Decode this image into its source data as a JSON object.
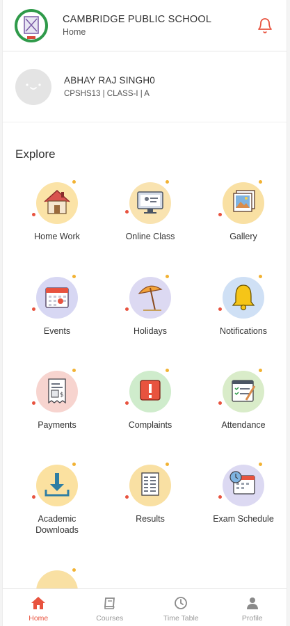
{
  "header": {
    "school_name": "CAMBRIDGE PUBLIC SCHOOL",
    "breadcrumb": "Home"
  },
  "profile": {
    "name": "ABHAY RAJ SINGH0",
    "meta": "CPSHS13 | CLASS-I | A"
  },
  "explore_title": "Explore",
  "explore_items": [
    {
      "label": "Home Work",
      "icon": "home-icon"
    },
    {
      "label": "Online Class",
      "icon": "online-class-icon"
    },
    {
      "label": "Gallery",
      "icon": "gallery-icon"
    },
    {
      "label": "Events",
      "icon": "calendar-icon"
    },
    {
      "label": "Holidays",
      "icon": "beach-umbrella-icon"
    },
    {
      "label": "Notifications",
      "icon": "bell-icon"
    },
    {
      "label": "Payments",
      "icon": "receipt-icon"
    },
    {
      "label": "Complaints",
      "icon": "alert-icon"
    },
    {
      "label": "Attendance",
      "icon": "clipboard-icon"
    },
    {
      "label": "Academic\nDownloads",
      "icon": "download-icon"
    },
    {
      "label": "Results",
      "icon": "report-icon"
    },
    {
      "label": "Exam Schedule",
      "icon": "schedule-icon"
    }
  ],
  "bottom_nav": [
    {
      "label": "Home",
      "icon": "home-icon",
      "active": true
    },
    {
      "label": "Courses",
      "icon": "book-icon",
      "active": false
    },
    {
      "label": "Time Table",
      "icon": "clock-icon",
      "active": false
    },
    {
      "label": "Profile",
      "icon": "user-icon",
      "active": false
    }
  ],
  "colors": {
    "accent": "#e8533f",
    "text": "#333333",
    "muted": "#999999"
  }
}
